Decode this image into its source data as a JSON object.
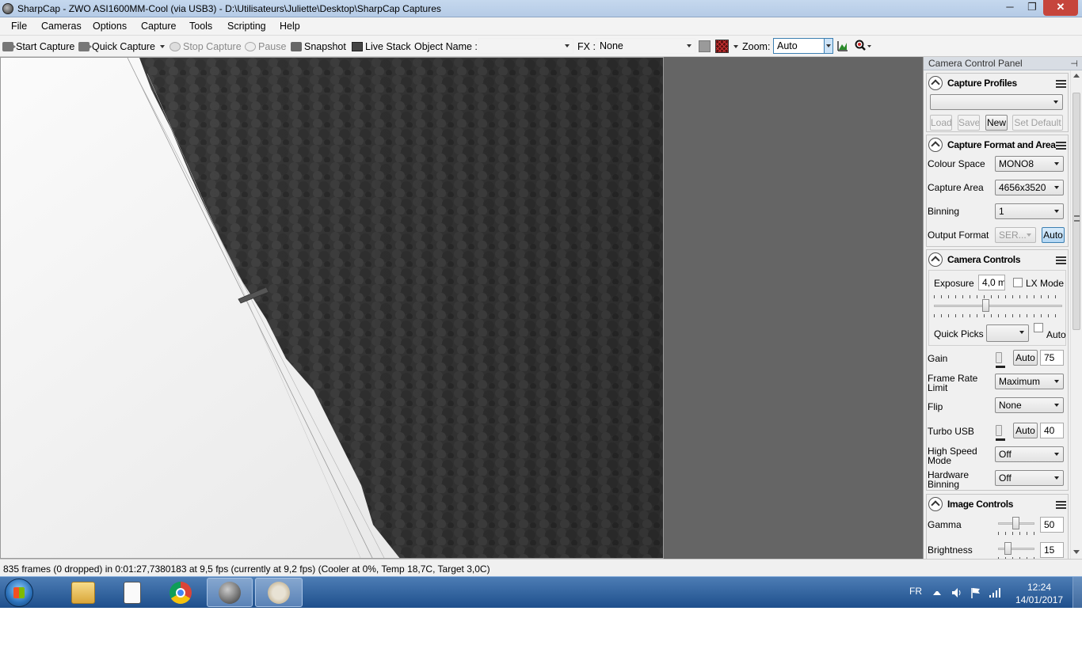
{
  "window": {
    "title": "SharpCap - ZWO ASI1600MM-Cool (via USB3) - D:\\Utilisateurs\\Juliette\\Desktop\\SharpCap Captures",
    "minimize": "─",
    "maximize": "❐",
    "close": "✕"
  },
  "menu": [
    "File",
    "Cameras",
    "Options",
    "Capture",
    "Tools",
    "Scripting",
    "Help"
  ],
  "toolbar": {
    "start_capture": "Start Capture",
    "quick_capture": "Quick Capture",
    "stop_capture": "Stop Capture",
    "pause": "Pause",
    "snapshot": "Snapshot",
    "live_stack": "Live Stack",
    "object_name_label": "Object Name :",
    "object_name_value": "",
    "fx_label": "FX :",
    "fx_value": "None",
    "zoom_label": "Zoom:",
    "zoom_value": "Auto"
  },
  "panel": {
    "title": "Camera Control Panel",
    "capture_profiles": {
      "title": "Capture Profiles",
      "profile_value": "",
      "load": "Load",
      "save": "Save",
      "new": "New",
      "set_default": "Set Default"
    },
    "format_area": {
      "title": "Capture Format and Area",
      "colour_space_label": "Colour Space",
      "colour_space_value": "MONO8",
      "capture_area_label": "Capture Area",
      "capture_area_value": "4656x3520",
      "binning_label": "Binning",
      "binning_value": "1",
      "output_format_label": "Output Format",
      "output_format_value": "SER...",
      "output_auto": "Auto"
    },
    "camera_controls": {
      "title": "Camera Controls",
      "exposure_label": "Exposure",
      "exposure_value": "4,0 m",
      "lx_mode": "LX Mode",
      "quick_picks_label": "Quick Picks",
      "quick_picks_auto": "Auto",
      "gain_label": "Gain",
      "gain_auto": "Auto",
      "gain_value": "75",
      "frame_rate_label": "Frame Rate Limit",
      "frame_rate_value": "Maximum",
      "flip_label": "Flip",
      "flip_value": "None",
      "turbo_label": "Turbo USB",
      "turbo_auto": "Auto",
      "turbo_value": "40",
      "high_speed_label": "High Speed Mode",
      "high_speed_value": "Off",
      "hw_binning_label": "Hardware Binning",
      "hw_binning_value": "Off"
    },
    "image_controls": {
      "title": "Image Controls",
      "gamma_label": "Gamma",
      "gamma_value": "50",
      "brightness_label": "Brightness",
      "brightness_value": "15"
    }
  },
  "status": "835 frames (0 dropped) in 0:01:27,7380183 at 9,5 fps  (currently at 9,2 fps) (Cooler at 0%, Temp 18,7C, Target 3,0C)",
  "taskbar": {
    "language": "FR",
    "time": "12:24",
    "date": "14/01/2017"
  }
}
